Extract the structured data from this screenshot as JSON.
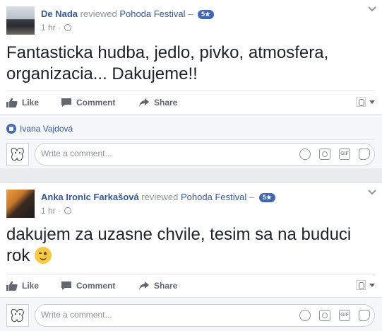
{
  "posts": [
    {
      "author": "De Nada",
      "verb": "reviewed",
      "page": "Pohoda Festival",
      "dash": "–",
      "rating": "5★",
      "time": "1 hr",
      "time_sep": "·",
      "text": "Fantasticka hudba, jedlo, pivko, atmosfera, organizacia... Dakujeme!!",
      "actions": {
        "like": "Like",
        "comment": "Comment",
        "share": "Share"
      },
      "likers": "Ivana Vajdová",
      "comment_placeholder": "Write a comment..."
    },
    {
      "author": "Anka Ironic Farkašová",
      "verb": "reviewed",
      "page": "Pohoda Festival",
      "dash": "–",
      "rating": "5★",
      "time": "1 hr",
      "time_sep": "·",
      "text": "dakujem za uzasne chvile, tesim sa na buduci rok",
      "emoji": "winking-face",
      "actions": {
        "like": "Like",
        "comment": "Comment",
        "share": "Share"
      },
      "comment_placeholder": "Write a comment..."
    }
  ],
  "gif_label": "GIF",
  "colors": {
    "link": "#365899",
    "muted": "#90949c",
    "action_text": "#606770",
    "rating_badge": "#4267b2",
    "feed_bg": "#e9ebee",
    "ufi_bg": "#f6f7f9"
  },
  "icons": [
    "globe-icon",
    "chevron-down-icon",
    "like-icon",
    "comment-icon",
    "share-icon",
    "emoji-icon",
    "camera-icon",
    "gif-icon",
    "sticker-icon"
  ]
}
